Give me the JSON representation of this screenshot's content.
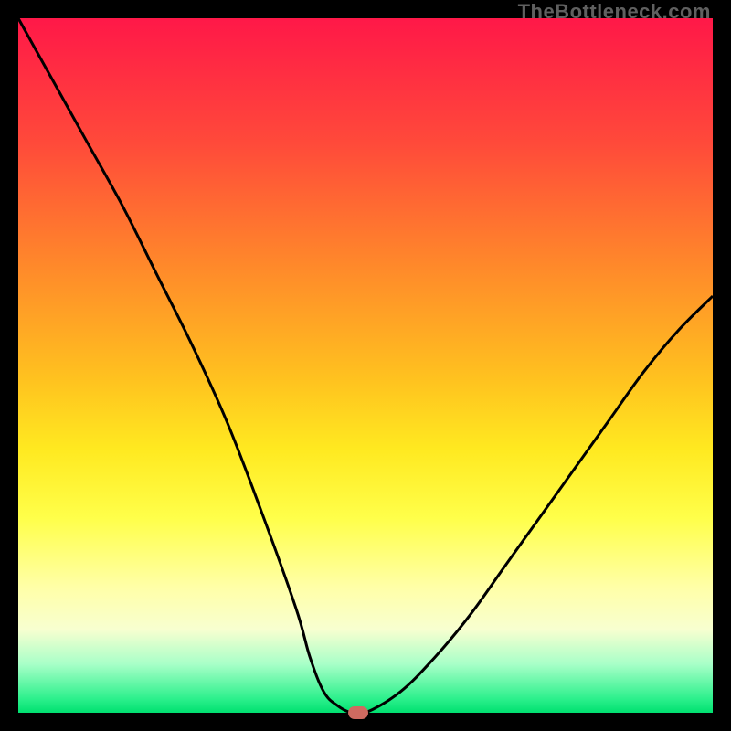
{
  "watermark": "TheBottleneck.com",
  "colors": {
    "frame": "#000000",
    "curve": "#000000",
    "marker": "#cf6a60",
    "gradient_top": "#ff1848",
    "gradient_bottom": "#00e070"
  },
  "chart_data": {
    "type": "line",
    "title": "",
    "xlabel": "",
    "ylabel": "",
    "xlim": [
      0,
      100
    ],
    "ylim": [
      0,
      100
    ],
    "x": [
      0,
      5,
      10,
      15,
      20,
      25,
      30,
      35,
      40,
      42,
      44,
      46,
      48,
      50,
      55,
      60,
      65,
      70,
      75,
      80,
      85,
      90,
      95,
      100
    ],
    "values": [
      100,
      91,
      82,
      73,
      63,
      53,
      42,
      29,
      15,
      8,
      3,
      1,
      0,
      0,
      3,
      8,
      14,
      21,
      28,
      35,
      42,
      49,
      55,
      60
    ],
    "marker": {
      "x": 49,
      "y": 0
    }
  }
}
